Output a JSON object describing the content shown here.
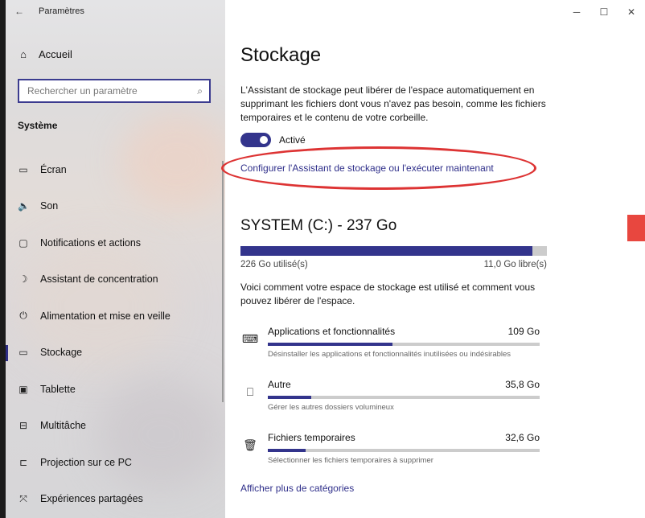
{
  "window": {
    "title": "Paramètres",
    "controls": {
      "minimize": "─",
      "maximize": "☐",
      "close": "✕"
    }
  },
  "sidebar": {
    "back_icon": "back-arrow-icon",
    "home": {
      "label": "Accueil",
      "icon": "home-icon"
    },
    "search": {
      "placeholder": "Rechercher un paramètre",
      "value": ""
    },
    "section_label": "Système",
    "items": [
      {
        "label": "Écran",
        "icon": "monitor-icon"
      },
      {
        "label": "Son",
        "icon": "speaker-icon"
      },
      {
        "label": "Notifications et actions",
        "icon": "notification-icon"
      },
      {
        "label": "Assistant de concentration",
        "icon": "moon-icon"
      },
      {
        "label": "Alimentation et mise en veille",
        "icon": "power-icon"
      },
      {
        "label": "Stockage",
        "icon": "storage-icon",
        "active": true
      },
      {
        "label": "Tablette",
        "icon": "tablet-icon"
      },
      {
        "label": "Multitâche",
        "icon": "multitask-icon"
      },
      {
        "label": "Projection sur ce PC",
        "icon": "projection-icon"
      },
      {
        "label": "Expériences partagées",
        "icon": "shared-icon"
      }
    ]
  },
  "main": {
    "title": "Stockage",
    "description": "L'Assistant de stockage peut libérer de l'espace automatiquement en supprimant les fichiers dont vous n'avez pas besoin, comme les fichiers temporaires et le contenu de votre corbeille.",
    "toggle": {
      "label": "Activé",
      "on": true
    },
    "config_link": "Configurer l'Assistant de stockage ou l'exécuter maintenant",
    "drive": {
      "title": "SYSTEM (C:) - 237 Go",
      "used_label": "226 Go utilisé(s)",
      "free_label": "11,0 Go libre(s)",
      "used_fraction": 0.954
    },
    "usage_description": "Voici comment votre espace de stockage est utilisé et comment vous pouvez libérer de l'espace.",
    "categories": [
      {
        "name": "Applications et fonctionnalités",
        "size": "109 Go",
        "subtitle": "Désinstaller les applications et fonctionnalités inutilisées ou indésirables",
        "icon": "keyboard-icon",
        "fraction": 0.46
      },
      {
        "name": "Autre",
        "size": "35,8 Go",
        "subtitle": "Gérer les autres dossiers volumineux",
        "icon": "document-icon",
        "fraction": 0.16
      },
      {
        "name": "Fichiers temporaires",
        "size": "32,6 Go",
        "subtitle": "Sélectionner les fichiers temporaires à supprimer",
        "icon": "trash-icon",
        "fraction": 0.14
      }
    ],
    "more_link": "Afficher plus de catégories"
  },
  "colors": {
    "accent": "#33348c",
    "link": "#2f2f8a",
    "annotation_red": "#dd3333",
    "bar_track": "#cccccc"
  }
}
